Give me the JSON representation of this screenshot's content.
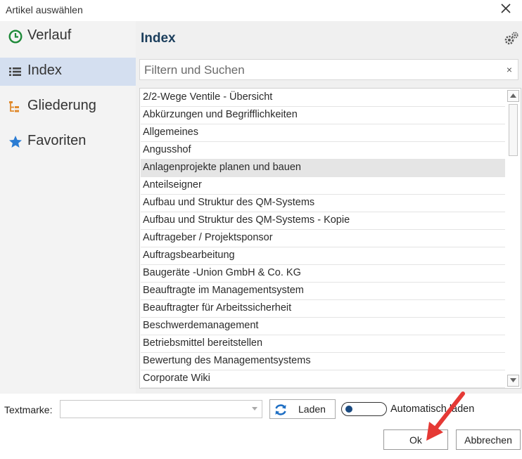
{
  "window": {
    "title": "Artikel auswählen"
  },
  "sidebar": {
    "items": [
      {
        "label": "Verlauf",
        "icon": "clock-icon"
      },
      {
        "label": "Index",
        "icon": "list-icon"
      },
      {
        "label": "Gliederung",
        "icon": "tree-icon"
      },
      {
        "label": "Favoriten",
        "icon": "star-icon"
      }
    ],
    "active": "Index"
  },
  "panel": {
    "title": "Index",
    "search": {
      "placeholder": "Filtern und Suchen",
      "value": "",
      "clear": "×"
    },
    "items": [
      "2/2-Wege Ventile - Übersicht",
      "Abkürzungen und Begrifflichkeiten",
      "Allgemeines",
      "Angusshof",
      "Anlagenprojekte planen und bauen",
      "Anteilseigner",
      "Aufbau und Struktur des QM-Systems",
      "Aufbau und Struktur des QM-Systems - Kopie",
      "Auftrageber / Projektsponsor",
      "Auftragsbearbeitung",
      "Baugeräte -Union GmbH & Co. KG",
      "Beauftragte im Managementsystem",
      "Beauftragter für Arbeitssicherheit",
      "Beschwerdemanagement",
      "Betriebsmittel bereitstellen",
      "Bewertung des Managementsystems",
      "Corporate Wiki"
    ],
    "selected_item": "Anlagenprojekte planen und bauen"
  },
  "bottom": {
    "textmarke_label": "Textmarke:",
    "textmarke_value": "",
    "laden_label": "Laden",
    "auto_label": "Automatisch laden",
    "auto_enabled": false,
    "ok_label": "Ok",
    "cancel_label": "Abbrechen"
  },
  "colors": {
    "accent_title": "#1b3e5c",
    "active_sidebar": "#d4dff0",
    "clock_icon": "#1f8a3a",
    "tree_icon": "#e08a2c",
    "star_icon": "#2b7cd3",
    "annotation_arrow": "#e53935"
  }
}
